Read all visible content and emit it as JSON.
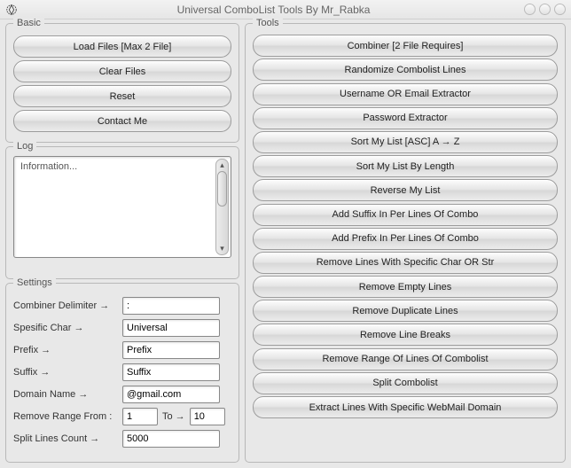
{
  "window": {
    "title": "Universal ComboList Tools By Mr_Rabka"
  },
  "basic": {
    "legend": "Basic",
    "load_label": "Load Files [Max 2 File]",
    "clear_label": "Clear Files",
    "reset_label": "Reset",
    "contact_label": "Contact Me"
  },
  "log": {
    "legend": "Log",
    "text": "Information..."
  },
  "settings": {
    "legend": "Settings",
    "combiner_delimiter_label": "Combiner Delimiter →",
    "combiner_delimiter_value": ":",
    "specific_char_label": "Spesific Char →",
    "specific_char_value": "Universal",
    "prefix_label": "Prefix →",
    "prefix_value": "Prefix",
    "suffix_label": "Suffix →",
    "suffix_value": "Suffix",
    "domain_name_label": "Domain Name →",
    "domain_name_value": "@gmail.com",
    "remove_range_from_label": "Remove Range From :",
    "remove_range_from_value": "1",
    "remove_range_to_label": "To →",
    "remove_range_to_value": "10",
    "split_lines_count_label": "Split Lines Count →",
    "split_lines_count_value": "5000"
  },
  "tools": {
    "legend": "Tools",
    "combiner": "Combiner [2 File Requires]",
    "randomize": "Randomize Combolist Lines",
    "username_extractor": "Username OR Email Extractor",
    "password_extractor": "Password Extractor",
    "sort_asc": "Sort My List [ASC] A → Z",
    "sort_length": "Sort My List By Length",
    "reverse": "Reverse My List",
    "add_suffix": "Add Suffix In Per Lines Of Combo",
    "add_prefix": "Add Prefix In Per Lines Of Combo",
    "remove_specific": "Remove Lines With Specific Char OR Str",
    "remove_empty": "Remove Empty Lines",
    "remove_duplicate": "Remove Duplicate Lines",
    "remove_breaks": "Remove Line Breaks",
    "remove_range": "Remove Range Of Lines Of Combolist",
    "split": "Split Combolist",
    "extract_webmail": "Extract Lines With Specific WebMail Domain"
  }
}
